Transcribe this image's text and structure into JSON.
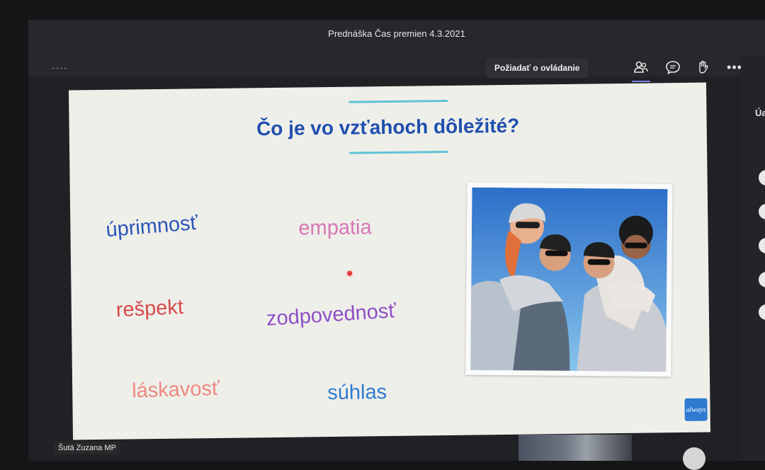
{
  "window": {
    "title": "Prednáška Čas premien 4.3.2021"
  },
  "toolbar": {
    "request_control_label": "Požiadať o ovládanie",
    "icons": [
      "participants-icon",
      "chat-icon",
      "raise-hand-icon",
      "more-options-icon"
    ],
    "more_label": "•••"
  },
  "right_panel": {
    "letter": "Úa"
  },
  "slide": {
    "title": "Čo je vo vzťahoch dôležité?",
    "words": [
      {
        "text": "úprimnosť",
        "color": "#2b55b8"
      },
      {
        "text": "empatia",
        "color": "#d876b6"
      },
      {
        "text": "rešpekt",
        "color": "#d64a4a"
      },
      {
        "text": "zodpovednosť",
        "color": "#8e4fc6"
      },
      {
        "text": "láskavosť",
        "color": "#ec8a80"
      },
      {
        "text": "súhlas",
        "color": "#2f7ad0"
      }
    ],
    "logo_text": "always"
  },
  "presenter": {
    "name": "Šutá Zuzana MP"
  },
  "colors": {
    "accent": "#7b83eb",
    "title": "#1f4fae",
    "decor": "#5fc3d6"
  }
}
